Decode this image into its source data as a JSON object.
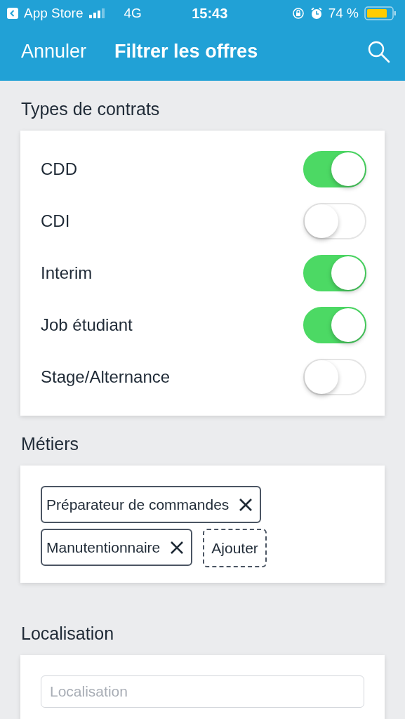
{
  "status_bar": {
    "back_app": "App Store",
    "network": "4G",
    "time": "15:43",
    "battery": "74 %"
  },
  "nav": {
    "cancel": "Annuler",
    "title": "Filtrer les offres"
  },
  "contracts": {
    "heading": "Types de contrats",
    "items": [
      {
        "label": "CDD",
        "on": true
      },
      {
        "label": "CDI",
        "on": false
      },
      {
        "label": "Interim",
        "on": true
      },
      {
        "label": "Job étudiant",
        "on": true
      },
      {
        "label": "Stage/Alternance",
        "on": false
      }
    ]
  },
  "jobs": {
    "heading": "Métiers",
    "tags": [
      {
        "label": "Préparateur de commandes"
      },
      {
        "label": "Manutentionnaire"
      }
    ],
    "add": "Ajouter"
  },
  "location": {
    "heading": "Localisation",
    "placeholder": "Localisation"
  }
}
